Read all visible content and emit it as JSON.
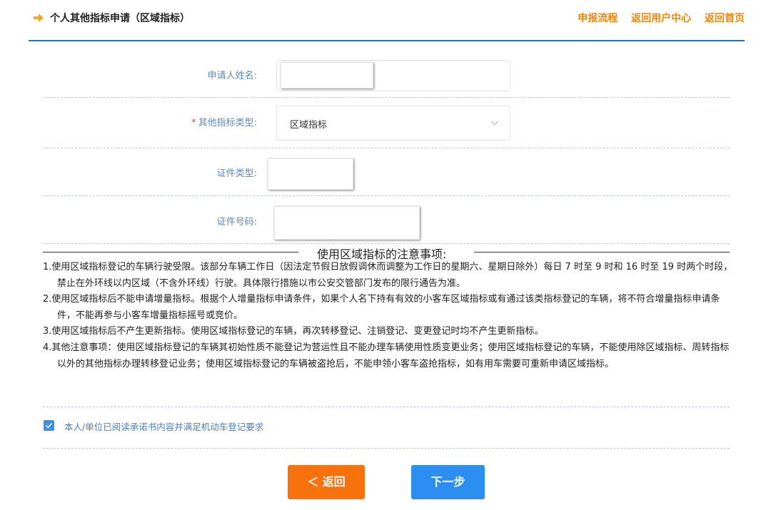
{
  "header": {
    "title": "个人其他指标申请（区域指标）",
    "nav": [
      "申报流程",
      "返回用户中心",
      "返回首页"
    ],
    "accent_color": "#f0870c",
    "icon": "right-arrow-icon"
  },
  "form": {
    "applicant_name_label": "申请人姓名:",
    "applicant_name_value": "",
    "indicator_type_required": "*",
    "indicator_type_label": "其他指标类型:",
    "indicator_type_value": "区域指标",
    "id_type_label": "证件类型:",
    "id_type_value": "",
    "id_number_label": "证件号码:",
    "id_number_value": ""
  },
  "notice": {
    "title": "使用区域指标的注意事项:",
    "items": [
      "1.使用区域指标登记的车辆行驶受限。该部分车辆工作日（因法定节假日放假调休而调整为工作日的星期六、星期日除外）每日 7 时至 9 时和 16 时至 19 时两个时段，禁止在外环线以内区域（不含外环线）行驶。具体限行措施以市公安交管部门发布的限行通告为准。",
      "2.使用区域指标后不能申请增量指标。根据个人增量指标申请条件，如果个人名下持有有效的小客车区域指标或有通过该类指标登记的车辆，将不符合增量指标申请条件，不能再参与小客车增量指标摇号或竞价。",
      "3.使用区域指标后不产生更新指标。使用区域指标登记的车辆，再次转移登记、注销登记、变更登记时均不产生更新指标。",
      "4.其他注意事项：使用区域指标登记的车辆其初始性质不能登记为营运性且不能办理车辆使用性质变更业务；使用区域指标登记的车辆，不能使用除区域指标、周转指标以外的其他指标办理转移登记业务；使用区域指标登记的车辆被盗抢后，不能申领小客车盗抢指标，如有用车需要可重新申请区域指标。"
    ]
  },
  "agreement": {
    "checked": true,
    "text": "本人/单位已阅读承诺书内容并满足机动车登记要求"
  },
  "buttons": {
    "back": "＜ 返回",
    "next": "下一步",
    "back_color": "#f7720c",
    "next_color": "#2d8ef2"
  }
}
